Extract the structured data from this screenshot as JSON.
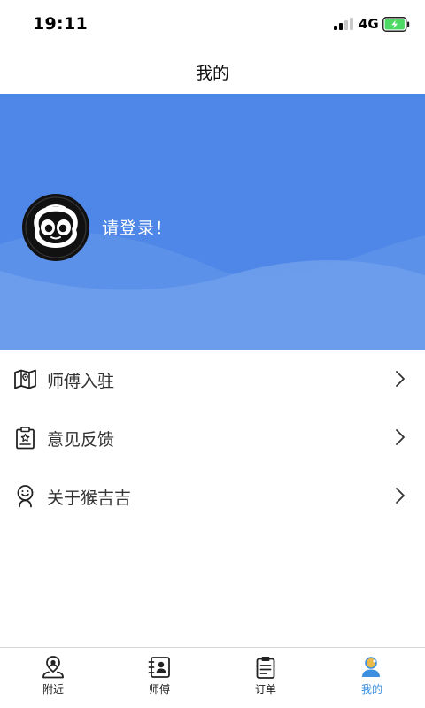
{
  "status_bar": {
    "time": "19:11",
    "network": "4G"
  },
  "nav": {
    "title": "我的"
  },
  "profile": {
    "login_prompt": "请登录！"
  },
  "menu": {
    "items": [
      {
        "label": "师傅入驻",
        "icon": "map-icon"
      },
      {
        "label": "意见反馈",
        "icon": "feedback-clipboard-icon"
      },
      {
        "label": "关于猴吉吉",
        "icon": "smile-person-icon"
      }
    ]
  },
  "tabs": [
    {
      "label": "附近",
      "icon": "location-person-icon",
      "active": false
    },
    {
      "label": "师傅",
      "icon": "contact-card-icon",
      "active": false
    },
    {
      "label": "订单",
      "icon": "order-clipboard-icon",
      "active": false
    },
    {
      "label": "我的",
      "icon": "user-profile-icon",
      "active": true
    }
  ],
  "colors": {
    "header_blue": "#4f87e8",
    "active_tab": "#3d8fe0",
    "battery_green": "#4cd964"
  }
}
